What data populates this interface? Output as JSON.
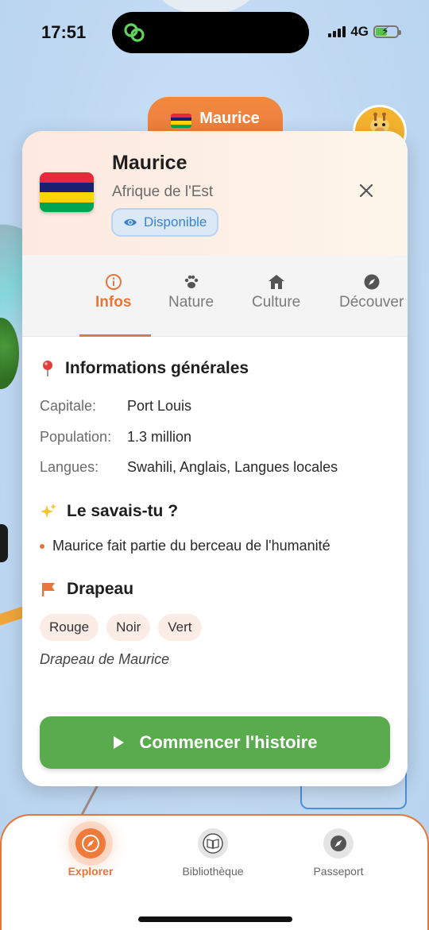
{
  "status_bar": {
    "time": "17:51",
    "network": "4G"
  },
  "country_pill": {
    "label": "Maurice"
  },
  "card": {
    "title": "Maurice",
    "subtitle": "Afrique de l'Est",
    "badge": "Disponible",
    "tabs": [
      {
        "label": "Infos",
        "icon": "info-icon",
        "active": true
      },
      {
        "label": "Nature",
        "icon": "paw-icon",
        "active": false
      },
      {
        "label": "Culture",
        "icon": "house-icon",
        "active": false
      },
      {
        "label": "Découver",
        "icon": "compass-icon",
        "active": false
      }
    ],
    "general": {
      "title": "Informations générales",
      "rows": [
        {
          "label": "Capitale:",
          "value": "Port Louis"
        },
        {
          "label": "Population:",
          "value": "1.3 million"
        },
        {
          "label": "Langues:",
          "value": "Swahili, Anglais, Langues locales"
        }
      ]
    },
    "fact": {
      "title": "Le savais-tu ?",
      "items": [
        "Maurice fait partie du berceau de l'humanité"
      ]
    },
    "flag": {
      "title": "Drapeau",
      "colors": [
        "Rouge",
        "Noir",
        "Vert"
      ],
      "caption": "Drapeau de Maurice"
    },
    "cta_label": "Commencer l'histoire"
  },
  "bottom_nav": {
    "items": [
      {
        "label": "Explorer",
        "icon": "compass-icon",
        "active": true
      },
      {
        "label": "Bibliothèque",
        "icon": "book-icon",
        "active": false
      },
      {
        "label": "Passeport",
        "icon": "compass-icon",
        "active": false
      }
    ]
  },
  "colors": {
    "accent": "#e8763a",
    "cta": "#5aab4e",
    "badge_text": "#3d82cc",
    "mauritius_flag": [
      "#ea2839",
      "#1a206d",
      "#ffd500",
      "#00a551"
    ]
  }
}
